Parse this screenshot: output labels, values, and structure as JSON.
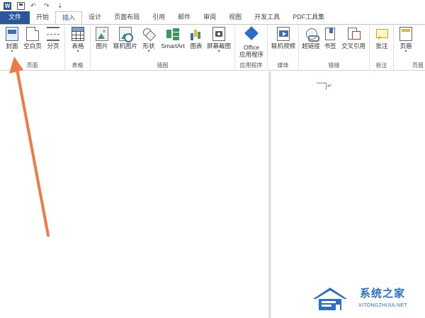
{
  "quick_access": {
    "app_icon": "W",
    "icons": [
      "word-icon",
      "save-icon",
      "undo-icon",
      "redo-icon",
      "customize-icon"
    ]
  },
  "tabs": [
    "文件",
    "开始",
    "插入",
    "设计",
    "页面布局",
    "引用",
    "邮件",
    "审阅",
    "视图",
    "开发工具",
    "PDF工具集"
  ],
  "active_tab": "插入",
  "ribbon": {
    "groups": {
      "pages": "页面",
      "tables": "表格",
      "illustrations": "插图",
      "apps": "应用程序",
      "media": "媒体",
      "links": "链接",
      "comments": "批注",
      "header_footer": "页眉"
    },
    "commands": {
      "cover": "封面",
      "blank_page": "空白页",
      "page_break": "分页",
      "table": "表格",
      "picture": "图片",
      "online_picture": "联机图片",
      "shapes": "形状",
      "smartart": "SmartArt",
      "chart": "图表",
      "screenshot": "屏幕截图",
      "office_apps_1": "Office",
      "office_apps_2": "应用程序",
      "online_video": "联机视频",
      "hyperlink": "超链接",
      "bookmark": "书签",
      "cross_ref": "交叉引用",
      "comment": "批注",
      "header": "页眉"
    },
    "dropdown_glyph": "▾"
  },
  "document": {
    "paragraph_mark": "↵"
  },
  "watermark": {
    "title": "系统之家",
    "url": "XITONGZHIJIA.NET"
  },
  "colors": {
    "accent": "#2b579a",
    "arrow": "#f07a45",
    "watermark": "#2a6fc9"
  }
}
